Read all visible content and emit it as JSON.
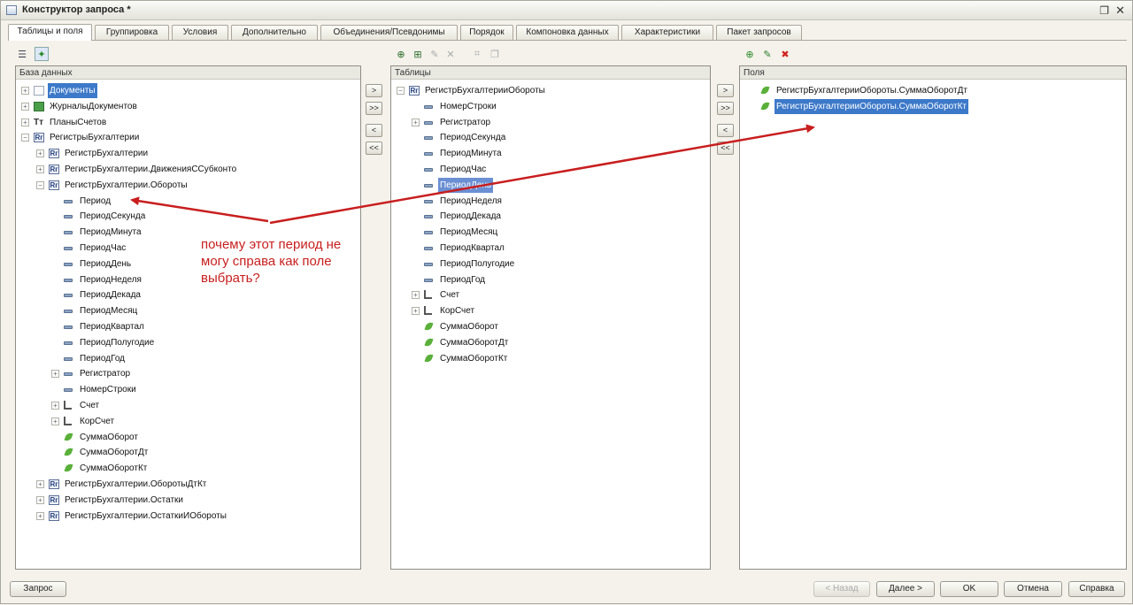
{
  "window": {
    "title": "Конструктор запроса *"
  },
  "tabs": [
    {
      "label": "Таблицы и поля"
    },
    {
      "label": "Группировка"
    },
    {
      "label": "Условия"
    },
    {
      "label": "Дополнительно"
    },
    {
      "label": "Объединения/Псевдонимы"
    },
    {
      "label": "Порядок"
    },
    {
      "label": "Компоновка данных"
    },
    {
      "label": "Характеристики"
    },
    {
      "label": "Пакет запросов"
    }
  ],
  "database": {
    "header": "База данных",
    "items": [
      {
        "label": "Документы",
        "icon": "document-icon"
      },
      {
        "label": "ЖурналыДокументов",
        "icon": "journal-icon"
      },
      {
        "label": "ПланыСчетов",
        "icon": "chart-of-accounts-icon"
      },
      {
        "label": "РегистрыБухгалтерии",
        "icon": "register-icon"
      },
      {
        "label": "РегистрБухгалтерии",
        "icon": "register-icon"
      },
      {
        "label": "РегистрБухгалтерии.ДвиженияССубконто",
        "icon": "register-icon"
      },
      {
        "label": "РегистрБухгалтерии.Обороты",
        "icon": "register-icon"
      },
      {
        "label": "Период",
        "icon": "field-icon"
      },
      {
        "label": "ПериодСекунда",
        "icon": "field-icon"
      },
      {
        "label": "ПериодМинута",
        "icon": "field-icon"
      },
      {
        "label": "ПериодЧас",
        "icon": "field-icon"
      },
      {
        "label": "ПериодДень",
        "icon": "field-icon"
      },
      {
        "label": "ПериодНеделя",
        "icon": "field-icon"
      },
      {
        "label": "ПериодДекада",
        "icon": "field-icon"
      },
      {
        "label": "ПериодМесяц",
        "icon": "field-icon"
      },
      {
        "label": "ПериодКвартал",
        "icon": "field-icon"
      },
      {
        "label": "ПериодПолугодие",
        "icon": "field-icon"
      },
      {
        "label": "ПериодГод",
        "icon": "field-icon"
      },
      {
        "label": "Регистратор",
        "icon": "field-icon"
      },
      {
        "label": "НомерСтроки",
        "icon": "field-icon"
      },
      {
        "label": "Счет",
        "icon": "dimension-icon"
      },
      {
        "label": "КорСчет",
        "icon": "dimension-icon"
      },
      {
        "label": "СуммаОборот",
        "icon": "resource-icon"
      },
      {
        "label": "СуммаОборотДт",
        "icon": "resource-icon"
      },
      {
        "label": "СуммаОборотКт",
        "icon": "resource-icon"
      },
      {
        "label": "РегистрБухгалтерии.ОборотыДтКт",
        "icon": "register-icon"
      },
      {
        "label": "РегистрБухгалтерии.Остатки",
        "icon": "register-icon"
      },
      {
        "label": "РегистрБухгалтерии.ОстаткиИОбороты",
        "icon": "register-icon"
      }
    ]
  },
  "tables": {
    "header": "Таблицы",
    "items": [
      {
        "label": "РегистрБухгалтерииОбороты",
        "icon": "register-icon"
      },
      {
        "label": "НомерСтроки",
        "icon": "field-icon"
      },
      {
        "label": "Регистратор",
        "icon": "field-icon"
      },
      {
        "label": "ПериодСекунда",
        "icon": "field-icon"
      },
      {
        "label": "ПериодМинута",
        "icon": "field-icon"
      },
      {
        "label": "ПериодЧас",
        "icon": "field-icon"
      },
      {
        "label": "ПериодДень",
        "icon": "field-icon"
      },
      {
        "label": "ПериодНеделя",
        "icon": "field-icon"
      },
      {
        "label": "ПериодДекада",
        "icon": "field-icon"
      },
      {
        "label": "ПериодМесяц",
        "icon": "field-icon"
      },
      {
        "label": "ПериодКвартал",
        "icon": "field-icon"
      },
      {
        "label": "ПериодПолугодие",
        "icon": "field-icon"
      },
      {
        "label": "ПериодГод",
        "icon": "field-icon"
      },
      {
        "label": "Счет",
        "icon": "dimension-icon"
      },
      {
        "label": "КорСчет",
        "icon": "dimension-icon"
      },
      {
        "label": "СуммаОборот",
        "icon": "resource-icon"
      },
      {
        "label": "СуммаОборотДт",
        "icon": "resource-icon"
      },
      {
        "label": "СуммаОборотКт",
        "icon": "resource-icon"
      }
    ]
  },
  "fields": {
    "header": "Поля",
    "items": [
      {
        "label": "РегистрБухгалтерииОбороты.СуммаОборотДт",
        "icon": "resource-icon"
      },
      {
        "label": "РегистрБухгалтерииОбороты.СуммаОборотКт",
        "icon": "resource-icon"
      }
    ]
  },
  "transfer_buttons": {
    "add": ">",
    "add_all": ">>",
    "remove": "<",
    "remove_all": "<<"
  },
  "annotation": {
    "text": "почему этот период не могу справа как поле выбрать?",
    "color": "#c81e1e"
  },
  "bottom": {
    "query": "Запрос",
    "back": "< Назад",
    "next": "Далее >",
    "ok": "OK",
    "cancel": "Отмена",
    "help": "Справка"
  },
  "colors": {
    "selection": "#3d79c9",
    "annotation": "#c81e1e"
  }
}
